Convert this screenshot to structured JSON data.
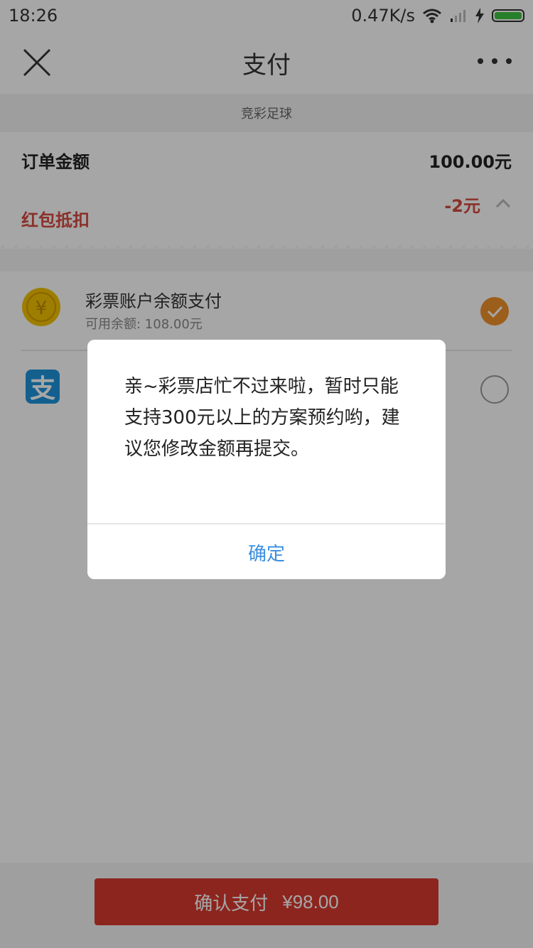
{
  "status_bar": {
    "time": "18:26",
    "speed": "0.47K/s"
  },
  "nav": {
    "title": "支付"
  },
  "content": {
    "subtitle": "竞彩足球",
    "order_label": "订单金额",
    "order_value": "100.00元",
    "redpack_label": "红包抵扣",
    "redpack_value": "-2元",
    "pay_methods": [
      {
        "title": "彩票账户余额支付",
        "sub": "可用余额: 108.00元",
        "selected": true
      },
      {
        "title": "",
        "sub": "",
        "selected": false
      }
    ]
  },
  "bottom": {
    "confirm_label": "确认支付",
    "amount": "¥98.00"
  },
  "dialog": {
    "message": "亲~彩票店忙不过来啦，暂时只能支持300元以上的方案预约哟，建议您修改金额再提交。",
    "ok_label": "确定"
  },
  "colors": {
    "accent": "#d7392e",
    "check": "#f0922a",
    "coin": "#f2c200",
    "alipay": "#1e94dc",
    "link": "#3b8fe0"
  },
  "icons": {
    "close": "close-icon",
    "more": "more-icon",
    "coin": "yen-coin-icon",
    "alipay": "alipay-icon",
    "check": "check-circle-icon",
    "chevron": "chevron-up-icon"
  }
}
